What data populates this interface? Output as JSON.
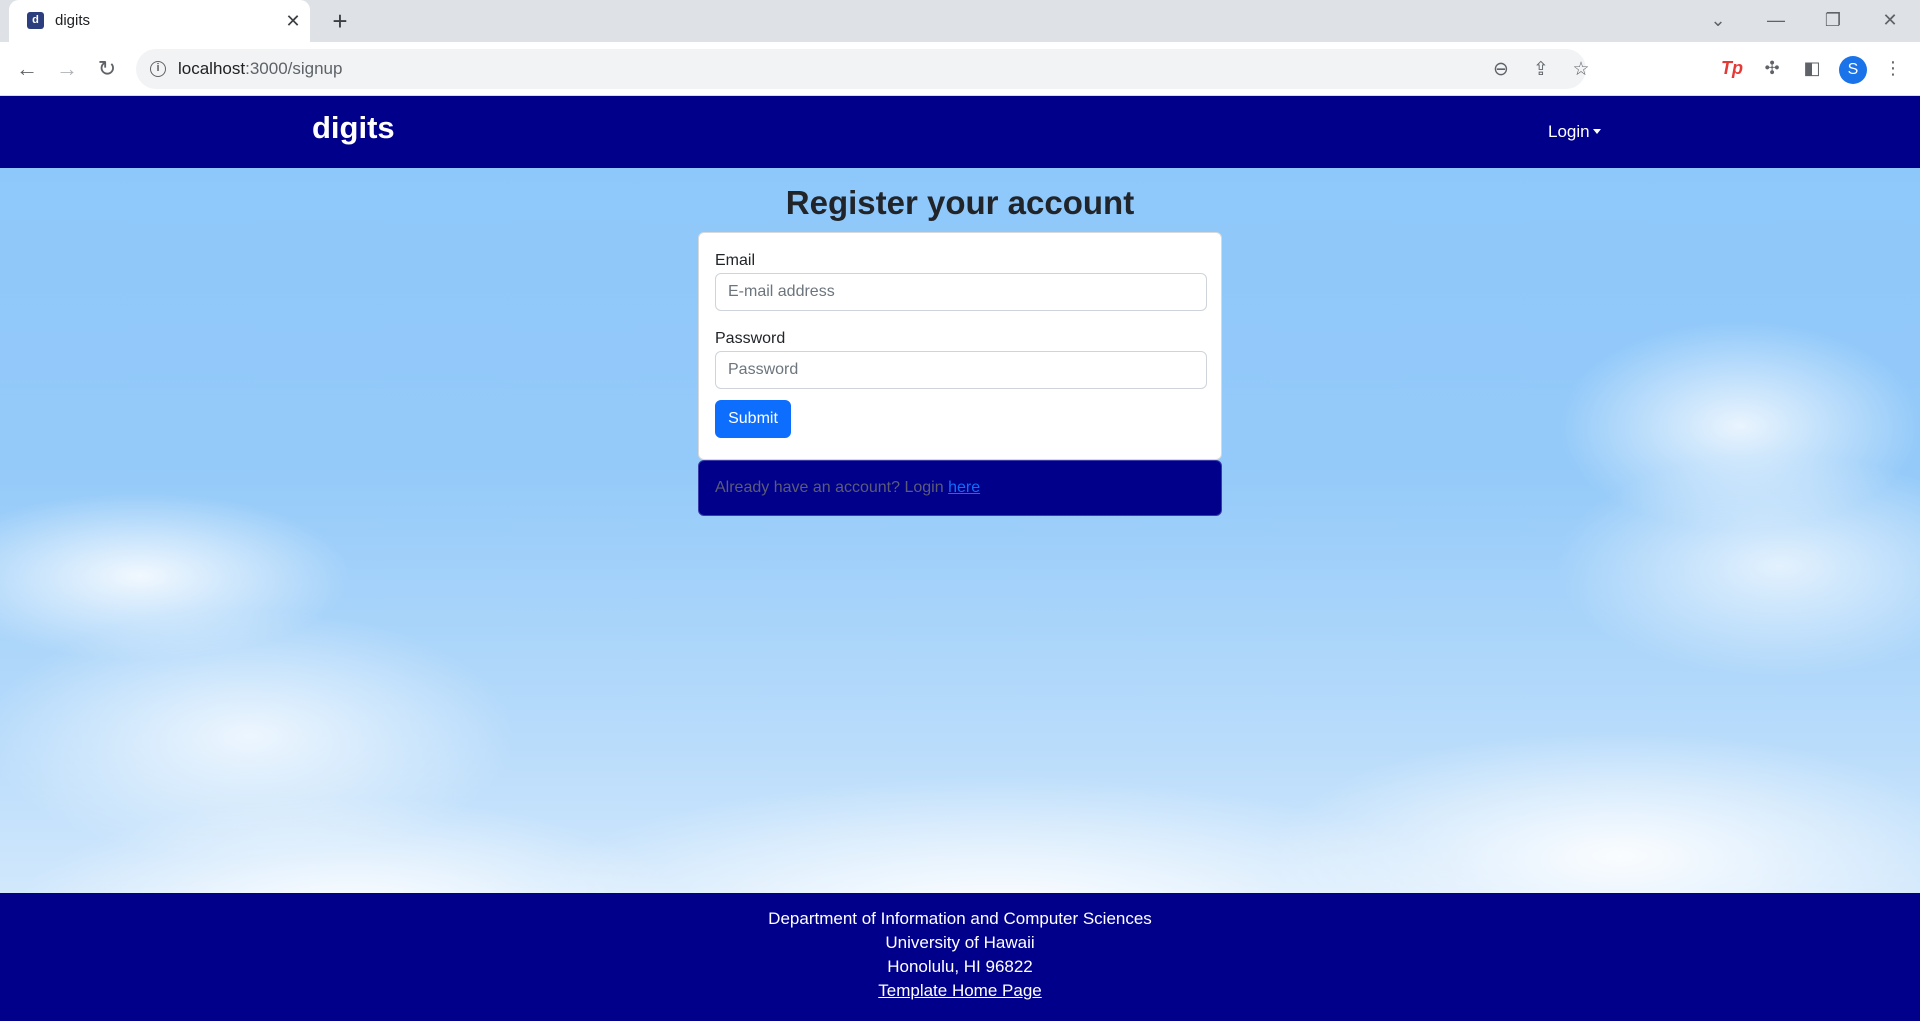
{
  "browser": {
    "tab_title": "digits",
    "tab_close": "✕",
    "new_tab": "+",
    "url_host": "localhost",
    "url_path": ":3000/signup",
    "window_controls": [
      "⌄",
      "—",
      "❐",
      "✕"
    ],
    "avatar_letter": "S",
    "icons": [
      "back-icon",
      "forward-icon",
      "reload-icon",
      "info-icon",
      "zoom-out-icon",
      "share-icon",
      "bookmark-star-icon",
      "tp-extension-icon",
      "puzzle-extension-icon",
      "side-panel-icon",
      "more-menu-icon"
    ]
  },
  "navbar": {
    "brand": "digits",
    "login_menu": "Login"
  },
  "signup": {
    "title": "Register your account",
    "email_label": "Email",
    "email_placeholder": "E-mail address",
    "password_label": "Password",
    "password_placeholder": "Password",
    "submit_label": "Submit",
    "login_prompt": "Already have an account? Login ",
    "login_link": "here"
  },
  "footer": {
    "line1": "Department of Information and Computer Sciences",
    "line2": "University of Hawaii",
    "line3": "Honolulu, HI 96822",
    "link": "Template Home Page"
  },
  "colors": {
    "navbar": "#00008b",
    "primary_button": "#0d6efd",
    "sky": "#8dc7fb"
  }
}
